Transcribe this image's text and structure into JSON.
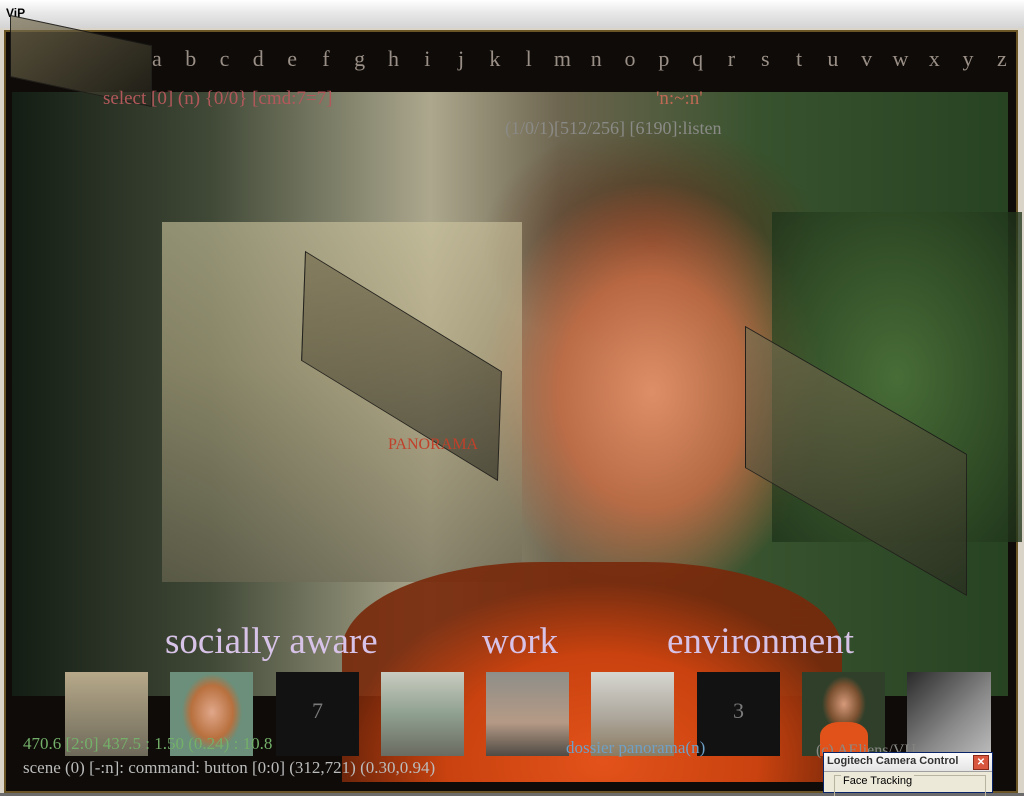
{
  "window": {
    "title": "ViP"
  },
  "alphabet": [
    "a",
    "b",
    "c",
    "d",
    "e",
    "f",
    "g",
    "h",
    "i",
    "j",
    "k",
    "l",
    "m",
    "n",
    "o",
    "p",
    "q",
    "r",
    "s",
    "t",
    "u",
    "v",
    "w",
    "x",
    "y",
    "z"
  ],
  "status": {
    "select": "select [0] (n) {0/0} [cmd:7=7]",
    "mode": "'n:~:n'",
    "listen": "(1/0/1)[512/256] [6190]:listen"
  },
  "overlay": {
    "panorama_label": "PANORAMA"
  },
  "phrase": {
    "word1": "socially aware",
    "word2": "work",
    "word3": "environment"
  },
  "thumbnails": [
    {
      "name": "thumb-corridor",
      "number": ""
    },
    {
      "name": "thumb-man-portrait",
      "number": ""
    },
    {
      "name": "thumb-number-7",
      "number": "7"
    },
    {
      "name": "thumb-bus-stop",
      "number": ""
    },
    {
      "name": "thumb-cafeteria",
      "number": ""
    },
    {
      "name": "thumb-hall",
      "number": ""
    },
    {
      "name": "thumb-number-3",
      "number": "3"
    },
    {
      "name": "thumb-woman-portrait",
      "number": ""
    },
    {
      "name": "thumb-photo-right",
      "number": ""
    }
  ],
  "footer": {
    "coords": "470.6 [2:0] 437.5 : 1.50 (0.24) : 10.8",
    "dossier": "dossier panorama(n)",
    "copyright": "(c) AEliens/VU",
    "scene": "scene (0) [-:n]: command: button [0:0] (312,721) (0.30,0.94)"
  },
  "dialog": {
    "title": "Logitech Camera Control",
    "close": "✕",
    "group": "Face Tracking"
  }
}
